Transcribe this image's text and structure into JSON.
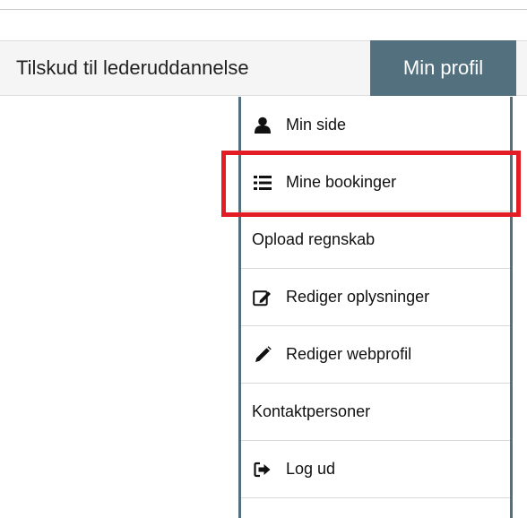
{
  "navbar": {
    "link_label": "Tilskud til lederuddannelse",
    "profile_label": "Min profil",
    "profile_color": "#53707f"
  },
  "menu": {
    "items": [
      {
        "label": "Min side",
        "icon": "user-icon"
      },
      {
        "label": "Mine bookinger",
        "icon": "list-icon"
      },
      {
        "label": "Opload regnskab",
        "icon": ""
      },
      {
        "label": "Rediger oplysninger",
        "icon": "edit-icon"
      },
      {
        "label": "Rediger webprofil",
        "icon": "pencil-icon"
      },
      {
        "label": "Kontaktpersoner",
        "icon": ""
      },
      {
        "label": "Log ud",
        "icon": "logout-icon"
      }
    ]
  },
  "highlight": {
    "target": "Mine bookinger",
    "color": "#e31d25"
  }
}
